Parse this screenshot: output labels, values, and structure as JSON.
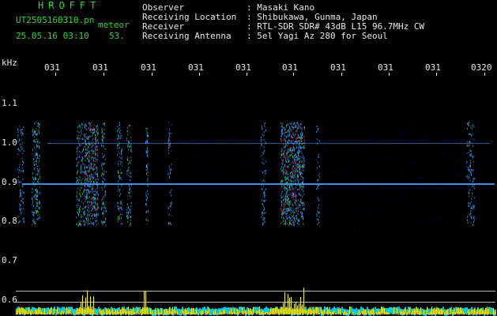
{
  "header": {
    "title": "HROFFT",
    "filename": "UT2505160310.pn",
    "filename_suffix": "meteor",
    "datetime": "25.05.16 03:10",
    "count": "53.",
    "rows": [
      {
        "label": "Observer",
        "value": ": Masaki Kano"
      },
      {
        "label": "Receiving Location",
        "value": ": Shibukawa, Gunma, Japan"
      },
      {
        "label": "Receiver",
        "value": ": RTL-SDR SDR# 43dB L15 96.7MHz CW"
      },
      {
        "label": "Receiving Antenna",
        "value": ": 5el Yagi Az 280 for Seoul"
      }
    ]
  },
  "axes": {
    "unit": "kHz",
    "x_ticks": [
      "031",
      "031",
      "031",
      "031",
      "031",
      "031",
      "031",
      "031",
      "031",
      "0320"
    ],
    "y_ticks": [
      "1.1",
      "1.0",
      "0.9",
      "0.8",
      "0.7",
      "0.6"
    ]
  },
  "colors": {
    "header_green": "#22dd33",
    "text": "#e8e8e8",
    "background": "#000000",
    "spectrum_base": "#0a0a7a",
    "burst_hot": "#ff3070",
    "burst_warm": "#20d060",
    "signal_line": "#40a0ff",
    "bottom_bars": "#ffff00",
    "bottom_floor": "#00e0ff"
  }
}
